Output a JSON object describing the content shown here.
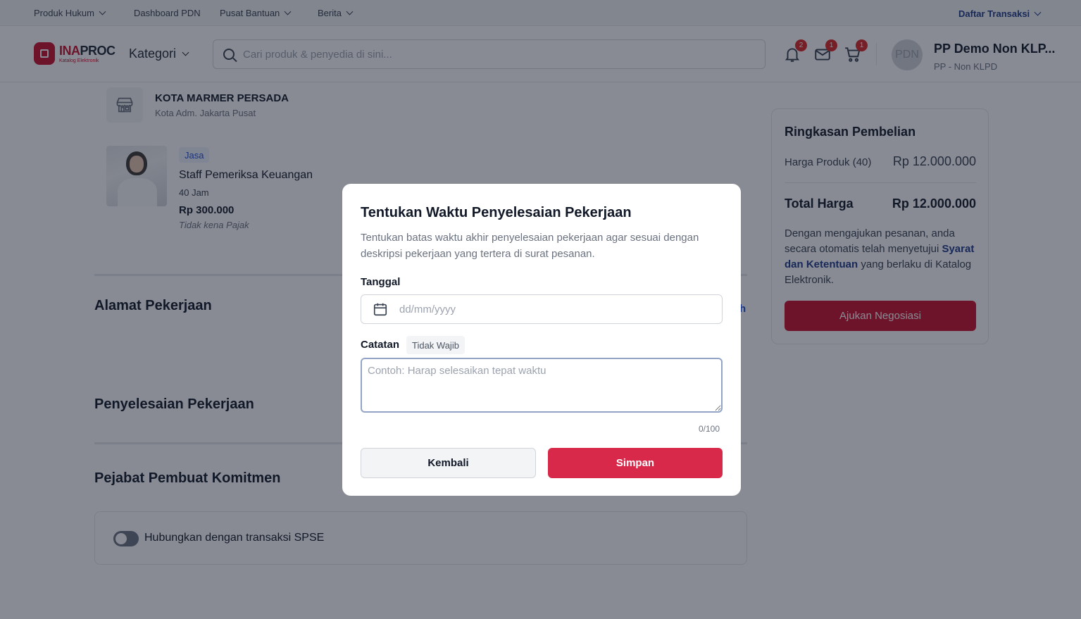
{
  "utility_bar": {
    "items": [
      "Produk Hukum",
      "Dashboard PDN",
      "Pusat Bantuan",
      "Berita"
    ],
    "right": "Daftar Transaksi"
  },
  "header": {
    "logo_main": "INAPROC",
    "logo_main_a": "INA",
    "logo_main_b": "PROC",
    "logo_sub": "Katalog Elektronik",
    "kategori": "Kategori",
    "search_placeholder": "Cari produk & penyedia di sini...",
    "badges": {
      "notifications": "2",
      "messages": "1",
      "cart": "1"
    },
    "avatar_initials": "PDN",
    "user_name": "PP Demo Non KLP...",
    "user_role": "PP - Non KLPD"
  },
  "store": {
    "name": "KOTA MARMER PERSADA",
    "location": "Kota Adm. Jakarta Pusat"
  },
  "product": {
    "tag": "Jasa",
    "name": "Staff Pemeriksa Keuangan",
    "duration": "40 Jam",
    "price": "Rp 300.000",
    "tax_note": "Tidak kena Pajak"
  },
  "sections": {
    "alamat": "Alamat Pekerjaan",
    "alamat_link_fragment": "h",
    "penyelesaian": "Penyelesaian Pekerjaan",
    "ppk": "Pejabat Pembuat Komitmen",
    "spse_label": "Hubungkan dengan transaksi SPSE"
  },
  "summary": {
    "title": "Ringkasan Pembelian",
    "product_label": "Harga Produk (40)",
    "product_value": "Rp 12.000.000",
    "total_label": "Total Harga",
    "total_value": "Rp 12.000.000",
    "note_before": "Dengan mengajukan pesanan, anda secara otomatis telah menyetujui ",
    "note_link": "Syarat dan Ketentuan",
    "note_after": " yang berlaku di Katalog Elektronik.",
    "button": "Ajukan Negosiasi"
  },
  "modal": {
    "title": "Tentukan Waktu Penyelesaian Pekerjaan",
    "description": "Tentukan batas waktu akhir penyelesaian pekerjaan agar sesuai dengan deskripsi pekerjaan yang tertera di surat pesanan.",
    "date_label": "Tanggal",
    "date_placeholder": "dd/mm/yyyy",
    "note_label": "Catatan",
    "note_optional": "Tidak Wajib",
    "note_placeholder": "Contoh: Harap selesaikan tepat waktu",
    "counter": "0/100",
    "back_button": "Kembali",
    "save_button": "Simpan"
  },
  "colors": {
    "brand_red": "#c8102e",
    "save_red": "#d9294a",
    "link_blue": "#1e3a8a"
  }
}
